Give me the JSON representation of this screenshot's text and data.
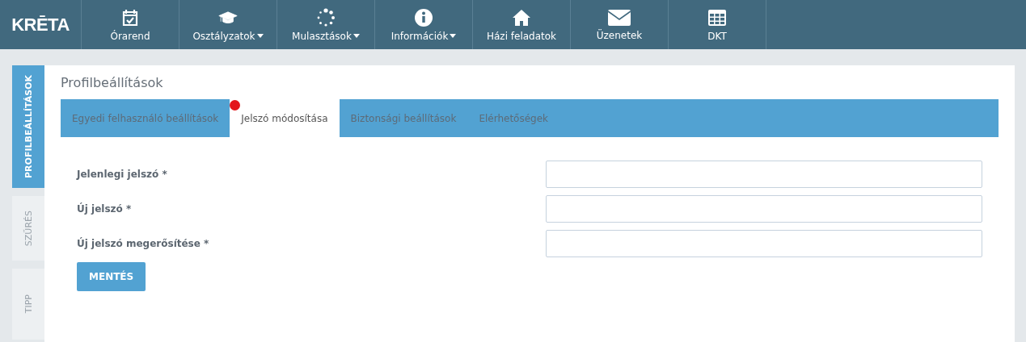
{
  "nav": {
    "logo": "KRĒTA",
    "items": [
      {
        "label": "Órarend",
        "dropdown": false
      },
      {
        "label": "Osztályzatok",
        "dropdown": true
      },
      {
        "label": "Mulasztások",
        "dropdown": true
      },
      {
        "label": "Információk",
        "dropdown": true
      },
      {
        "label": "Házi feladatok",
        "dropdown": false
      },
      {
        "label": "Üzenetek",
        "dropdown": false
      },
      {
        "label": "DKT",
        "dropdown": false
      }
    ]
  },
  "side_tabs": [
    {
      "label": "PROFILBEÁLLÍTÁSOK",
      "selected": true
    },
    {
      "label": "SZŰRÉS",
      "selected": false
    },
    {
      "label": "TIPP",
      "selected": false
    }
  ],
  "page_title": "Profilbeállítások",
  "tabs": [
    {
      "label": "Egyedi felhasználó beállítások",
      "selected": false,
      "notification": false
    },
    {
      "label": "Jelszó módosítása",
      "selected": true,
      "notification": true
    },
    {
      "label": "Biztonsági beállítások",
      "selected": false,
      "notification": false
    },
    {
      "label": "Elérhetőségek",
      "selected": false,
      "notification": false
    }
  ],
  "form": {
    "fields": [
      {
        "label": "Jelenlegi jelszó *"
      },
      {
        "label": "Új jelszó *"
      },
      {
        "label": "Új jelszó megerősítése *"
      }
    ],
    "save_button": "MENTÉS"
  }
}
